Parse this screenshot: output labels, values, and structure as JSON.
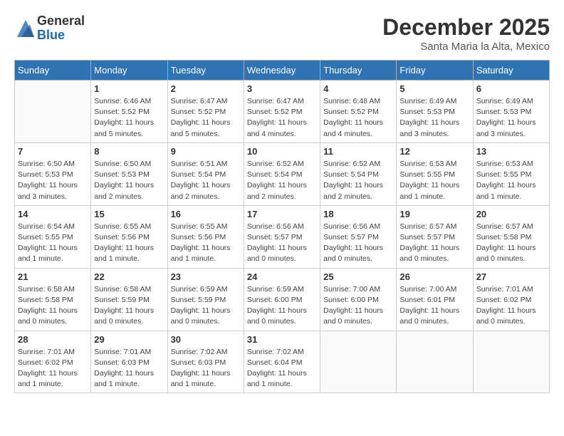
{
  "logo": {
    "line1": "General",
    "line2": "Blue"
  },
  "title": "December 2025",
  "location": "Santa Maria la Alta, Mexico",
  "weekdays": [
    "Sunday",
    "Monday",
    "Tuesday",
    "Wednesday",
    "Thursday",
    "Friday",
    "Saturday"
  ],
  "weeks": [
    [
      {
        "day": "",
        "info": ""
      },
      {
        "day": "1",
        "info": "Sunrise: 6:46 AM\nSunset: 5:52 PM\nDaylight: 11 hours\nand 5 minutes."
      },
      {
        "day": "2",
        "info": "Sunrise: 6:47 AM\nSunset: 5:52 PM\nDaylight: 11 hours\nand 5 minutes."
      },
      {
        "day": "3",
        "info": "Sunrise: 6:47 AM\nSunset: 5:52 PM\nDaylight: 11 hours\nand 4 minutes."
      },
      {
        "day": "4",
        "info": "Sunrise: 6:48 AM\nSunset: 5:52 PM\nDaylight: 11 hours\nand 4 minutes."
      },
      {
        "day": "5",
        "info": "Sunrise: 6:49 AM\nSunset: 5:53 PM\nDaylight: 11 hours\nand 3 minutes."
      },
      {
        "day": "6",
        "info": "Sunrise: 6:49 AM\nSunset: 5:53 PM\nDaylight: 11 hours\nand 3 minutes."
      }
    ],
    [
      {
        "day": "7",
        "info": "Sunrise: 6:50 AM\nSunset: 5:53 PM\nDaylight: 11 hours\nand 3 minutes."
      },
      {
        "day": "8",
        "info": "Sunrise: 6:50 AM\nSunset: 5:53 PM\nDaylight: 11 hours\nand 2 minutes."
      },
      {
        "day": "9",
        "info": "Sunrise: 6:51 AM\nSunset: 5:54 PM\nDaylight: 11 hours\nand 2 minutes."
      },
      {
        "day": "10",
        "info": "Sunrise: 6:52 AM\nSunset: 5:54 PM\nDaylight: 11 hours\nand 2 minutes."
      },
      {
        "day": "11",
        "info": "Sunrise: 6:52 AM\nSunset: 5:54 PM\nDaylight: 11 hours\nand 2 minutes."
      },
      {
        "day": "12",
        "info": "Sunrise: 6:53 AM\nSunset: 5:55 PM\nDaylight: 11 hours\nand 1 minute."
      },
      {
        "day": "13",
        "info": "Sunrise: 6:53 AM\nSunset: 5:55 PM\nDaylight: 11 hours\nand 1 minute."
      }
    ],
    [
      {
        "day": "14",
        "info": "Sunrise: 6:54 AM\nSunset: 5:55 PM\nDaylight: 11 hours\nand 1 minute."
      },
      {
        "day": "15",
        "info": "Sunrise: 6:55 AM\nSunset: 5:56 PM\nDaylight: 11 hours\nand 1 minute."
      },
      {
        "day": "16",
        "info": "Sunrise: 6:55 AM\nSunset: 5:56 PM\nDaylight: 11 hours\nand 1 minute."
      },
      {
        "day": "17",
        "info": "Sunrise: 6:56 AM\nSunset: 5:57 PM\nDaylight: 11 hours\nand 0 minutes."
      },
      {
        "day": "18",
        "info": "Sunrise: 6:56 AM\nSunset: 5:57 PM\nDaylight: 11 hours\nand 0 minutes."
      },
      {
        "day": "19",
        "info": "Sunrise: 6:57 AM\nSunset: 5:57 PM\nDaylight: 11 hours\nand 0 minutes."
      },
      {
        "day": "20",
        "info": "Sunrise: 6:57 AM\nSunset: 5:58 PM\nDaylight: 11 hours\nand 0 minutes."
      }
    ],
    [
      {
        "day": "21",
        "info": "Sunrise: 6:58 AM\nSunset: 5:58 PM\nDaylight: 11 hours\nand 0 minutes."
      },
      {
        "day": "22",
        "info": "Sunrise: 6:58 AM\nSunset: 5:59 PM\nDaylight: 11 hours\nand 0 minutes."
      },
      {
        "day": "23",
        "info": "Sunrise: 6:59 AM\nSunset: 5:59 PM\nDaylight: 11 hours\nand 0 minutes."
      },
      {
        "day": "24",
        "info": "Sunrise: 6:59 AM\nSunset: 6:00 PM\nDaylight: 11 hours\nand 0 minutes."
      },
      {
        "day": "25",
        "info": "Sunrise: 7:00 AM\nSunset: 6:00 PM\nDaylight: 11 hours\nand 0 minutes."
      },
      {
        "day": "26",
        "info": "Sunrise: 7:00 AM\nSunset: 6:01 PM\nDaylight: 11 hours\nand 0 minutes."
      },
      {
        "day": "27",
        "info": "Sunrise: 7:01 AM\nSunset: 6:02 PM\nDaylight: 11 hours\nand 0 minutes."
      }
    ],
    [
      {
        "day": "28",
        "info": "Sunrise: 7:01 AM\nSunset: 6:02 PM\nDaylight: 11 hours\nand 1 minute."
      },
      {
        "day": "29",
        "info": "Sunrise: 7:01 AM\nSunset: 6:03 PM\nDaylight: 11 hours\nand 1 minute."
      },
      {
        "day": "30",
        "info": "Sunrise: 7:02 AM\nSunset: 6:03 PM\nDaylight: 11 hours\nand 1 minute."
      },
      {
        "day": "31",
        "info": "Sunrise: 7:02 AM\nSunset: 6:04 PM\nDaylight: 11 hours\nand 1 minute."
      },
      {
        "day": "",
        "info": ""
      },
      {
        "day": "",
        "info": ""
      },
      {
        "day": "",
        "info": ""
      }
    ]
  ]
}
